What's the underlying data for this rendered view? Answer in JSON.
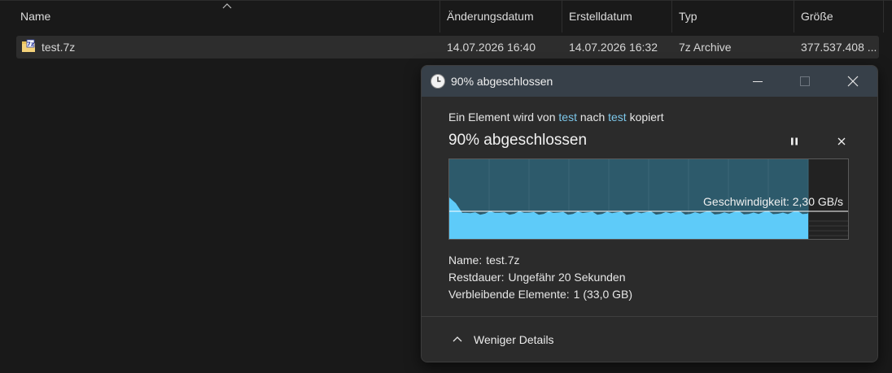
{
  "explorer": {
    "columns": [
      "Name",
      "Änderungsdatum",
      "Erstelldatum",
      "Typ",
      "Größe"
    ],
    "file": {
      "name": "test.7z",
      "modified": "14.07.2026 16:40",
      "created": "14.07.2026 16:32",
      "type": "7z Archive",
      "size": "377.537.408 ..."
    }
  },
  "dialog": {
    "title": "90% abgeschlossen",
    "description_prefix": "Ein Element wird von ",
    "source": "test",
    "description_middle": " nach ",
    "destination": "test",
    "description_suffix": " kopiert",
    "progress_heading": "90% abgeschlossen",
    "progress_percent": 90,
    "speed_label": "Geschwindigkeit: 2,30 GB/s",
    "details": {
      "name_label": "Name:",
      "name_value": "test.7z",
      "remaining_time_label": "Restdauer:",
      "remaining_time_value": "Ungefähr 20 Sekunden",
      "remaining_items_label": "Verbleibende Elemente:",
      "remaining_items_value": "1 (33,0 GB)"
    },
    "less_details_label": "Weniger Details"
  },
  "colors": {
    "titlebar": "#374049",
    "link": "#7cc7ea",
    "graph_fill": "#5ecbf9",
    "graph_progress_bg": "#2d5a6b"
  },
  "icons": {
    "file": "7z-archive-icon",
    "title": "clock-icon",
    "pause": "pause-icon",
    "cancel": "close-icon",
    "collapse": "chevron-up-icon"
  }
}
